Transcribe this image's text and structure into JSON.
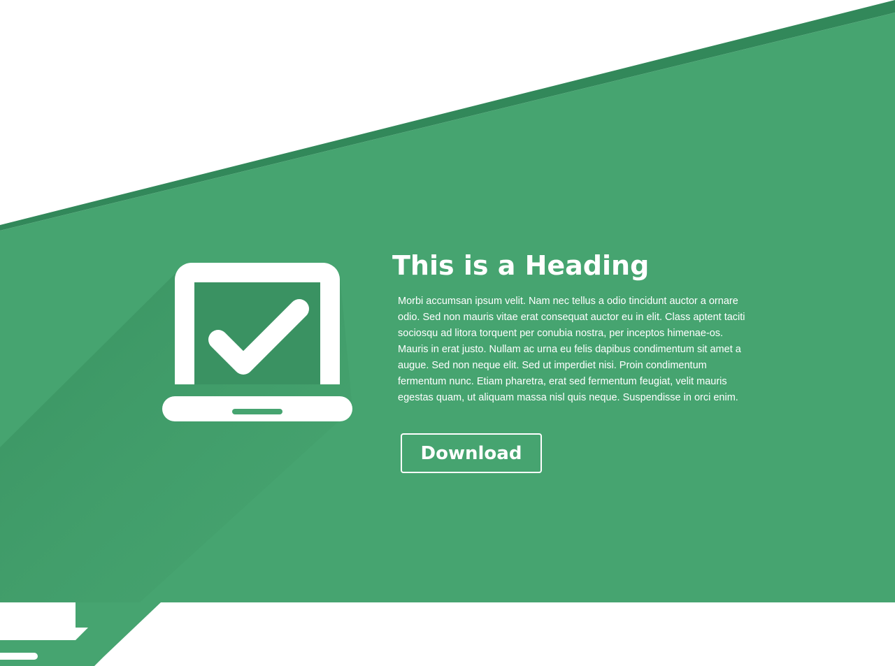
{
  "colors": {
    "brand_green": "#46a470",
    "dark_green_band": "#32885a",
    "shadow_green": "#3b9462",
    "white": "#ffffff"
  },
  "hero": {
    "icon": "laptop-check-icon",
    "heading": "This is a Heading",
    "body": "Morbi accumsan ipsum velit. Nam nec tellus a odio tincidunt auctor a ornare odio. Sed non  mauris vitae erat consequat auctor eu in elit. Class aptent taciti sociosqu ad litora torquent per conubia nostra, per inceptos himenae-os. Mauris in erat justo. Nullam ac urna eu felis dapibus condimentum sit amet a augue. Sed non neque elit. Sed ut imperdiet nisi. Proin condimentum fermentum nunc. Etiam pharetra, erat sed fermentum feugiat, velit mauris egestas quam, ut aliquam massa nisl quis neque. Suspendisse in orci enim.",
    "download_label": "Download"
  },
  "decor": {
    "partial_laptop_icon": "laptop-icon"
  }
}
